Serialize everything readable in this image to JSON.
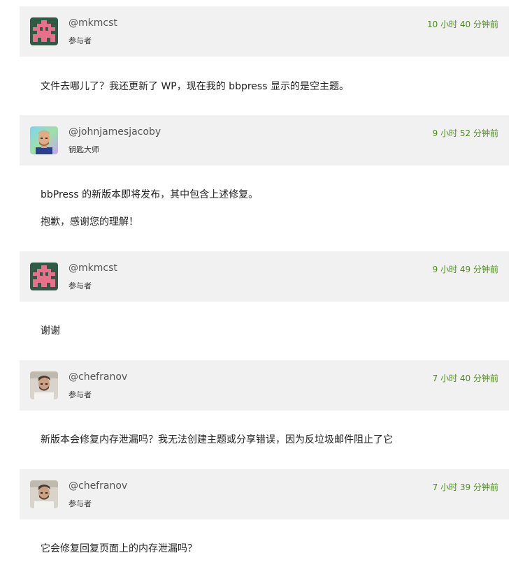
{
  "accent_color": "#4d8b1c",
  "header_bg": "#f1f1f1",
  "posts": [
    {
      "username": "@mkmcst",
      "role": "参与者",
      "time": "10 小时 40 分钟前",
      "avatar": "pixel-invader-avatar",
      "paragraphs": [
        "文件去哪儿了？我还更新了 WP，现在我的 bbpress 显示的是空主题。"
      ]
    },
    {
      "username": "@johnjamesjacoby",
      "role": "钥匙大师",
      "time": "9 小时 52 分钟前",
      "avatar": "photo-avatar-johnjamesjacoby",
      "paragraphs": [
        "bbPress 的新版本即将发布，其中包含上述修复。",
        "抱歉，感谢您的理解！"
      ]
    },
    {
      "username": "@mkmcst",
      "role": "参与者",
      "time": "9 小时 49 分钟前",
      "avatar": "pixel-invader-avatar",
      "paragraphs": [
        "谢谢"
      ]
    },
    {
      "username": "@chefranov",
      "role": "参与者",
      "time": "7 小时 40 分钟前",
      "avatar": "photo-avatar-chefranov",
      "paragraphs": [
        "新版本会修复内存泄漏吗？我无法创建主题或分享错误，因为反垃圾邮件阻止了它"
      ]
    },
    {
      "username": "@chefranov",
      "role": "参与者",
      "time": "7 小时 39 分钟前",
      "avatar": "photo-avatar-chefranov",
      "paragraphs": [
        "它会修复回复页面上的内存泄漏吗？"
      ]
    }
  ]
}
